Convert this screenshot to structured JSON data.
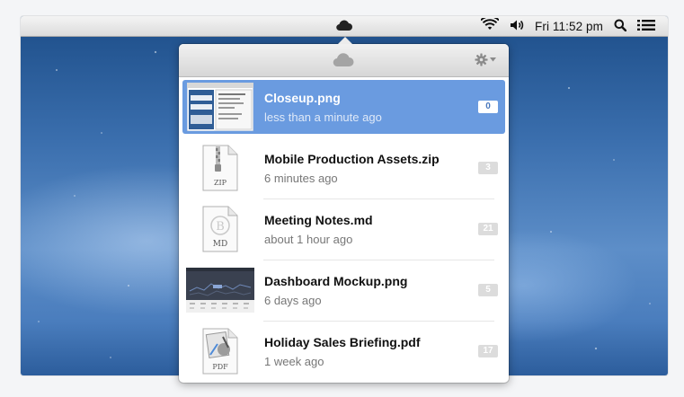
{
  "menubar": {
    "clock": "Fri 11:52 pm",
    "icons": [
      "cloud-icon",
      "wifi-icon",
      "volume-icon",
      "search-icon",
      "list-icon"
    ]
  },
  "popover": {
    "header_icon": "cloud-icon",
    "settings_icon": "gear-icon",
    "files": [
      {
        "name": "Closeup.png",
        "time": "less than a minute ago",
        "count": "0",
        "thumb": "screenshot-thumbnail",
        "selected": true
      },
      {
        "name": "Mobile Production Assets.zip",
        "time": "6 minutes ago",
        "count": "3",
        "thumb": "zip-file-icon",
        "thumb_label": "ZIP"
      },
      {
        "name": "Meeting Notes.md",
        "time": "about 1 hour ago",
        "count": "21",
        "thumb": "markdown-file-icon",
        "thumb_label": "MD",
        "thumb_glyph": "B"
      },
      {
        "name": "Dashboard Mockup.png",
        "time": "6 days ago",
        "count": "5",
        "thumb": "dashboard-thumbnail"
      },
      {
        "name": "Holiday Sales Briefing.pdf",
        "time": "1 week ago",
        "count": "17",
        "thumb": "pdf-file-icon",
        "thumb_label": "PDF"
      }
    ]
  },
  "colors": {
    "selection": "#6a9be0",
    "badge": "#dcdcdc",
    "desktop": "#3b6fae"
  }
}
